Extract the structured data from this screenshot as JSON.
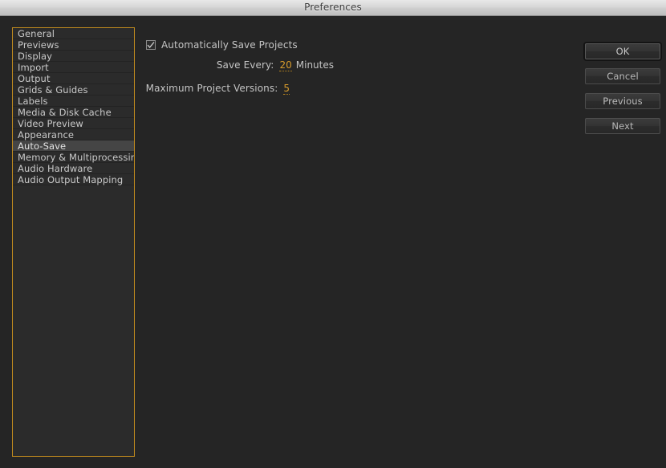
{
  "window": {
    "title": "Preferences"
  },
  "sidebar": {
    "selected": "Auto-Save",
    "items": [
      {
        "label": "General"
      },
      {
        "label": "Previews"
      },
      {
        "label": "Display"
      },
      {
        "label": "Import"
      },
      {
        "label": "Output"
      },
      {
        "label": "Grids & Guides"
      },
      {
        "label": "Labels"
      },
      {
        "label": "Media & Disk Cache"
      },
      {
        "label": "Video Preview"
      },
      {
        "label": "Appearance"
      },
      {
        "label": "Auto-Save"
      },
      {
        "label": "Memory & Multiprocessing"
      },
      {
        "label": "Audio Hardware"
      },
      {
        "label": "Audio Output Mapping"
      }
    ]
  },
  "panel": {
    "auto_save_checkbox": {
      "label": "Automatically Save Projects",
      "checked": true,
      "icon": "checkmark-icon"
    },
    "save_every": {
      "label": "Save Every:",
      "value": "20",
      "unit": "Minutes"
    },
    "max_versions": {
      "label": "Maximum Project Versions:",
      "value": "5"
    }
  },
  "buttons": [
    {
      "label": "OK",
      "default": true
    },
    {
      "label": "Cancel",
      "default": false
    },
    {
      "label": "Previous",
      "default": false
    },
    {
      "label": "Next",
      "default": false
    }
  ],
  "colors": {
    "accent_border": "#c08a1e",
    "value_text": "#d89c2c",
    "background": "#252525",
    "panel_background": "#2b2b2b",
    "selection": "#454545"
  }
}
